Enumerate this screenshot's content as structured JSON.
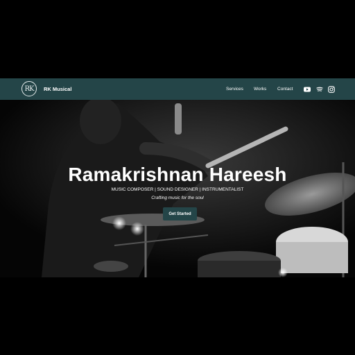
{
  "brand": {
    "logo_text": "RK",
    "name": "RK Musical"
  },
  "nav": {
    "links": [
      "Services",
      "Works",
      "Contact"
    ]
  },
  "social": [
    "youtube-icon",
    "spotify-icon",
    "instagram-icon"
  ],
  "hero": {
    "title": "Ramakrishnan Hareesh",
    "subtitle": "MUSIC COMPOSER | SOUND DESIGNER | INSTRUMENTALIST",
    "tagline": "Crafting music for the soul",
    "cta_label": "Get Started"
  },
  "colors": {
    "accent": "#244548",
    "background": "#000000",
    "text": "#ffffff"
  }
}
